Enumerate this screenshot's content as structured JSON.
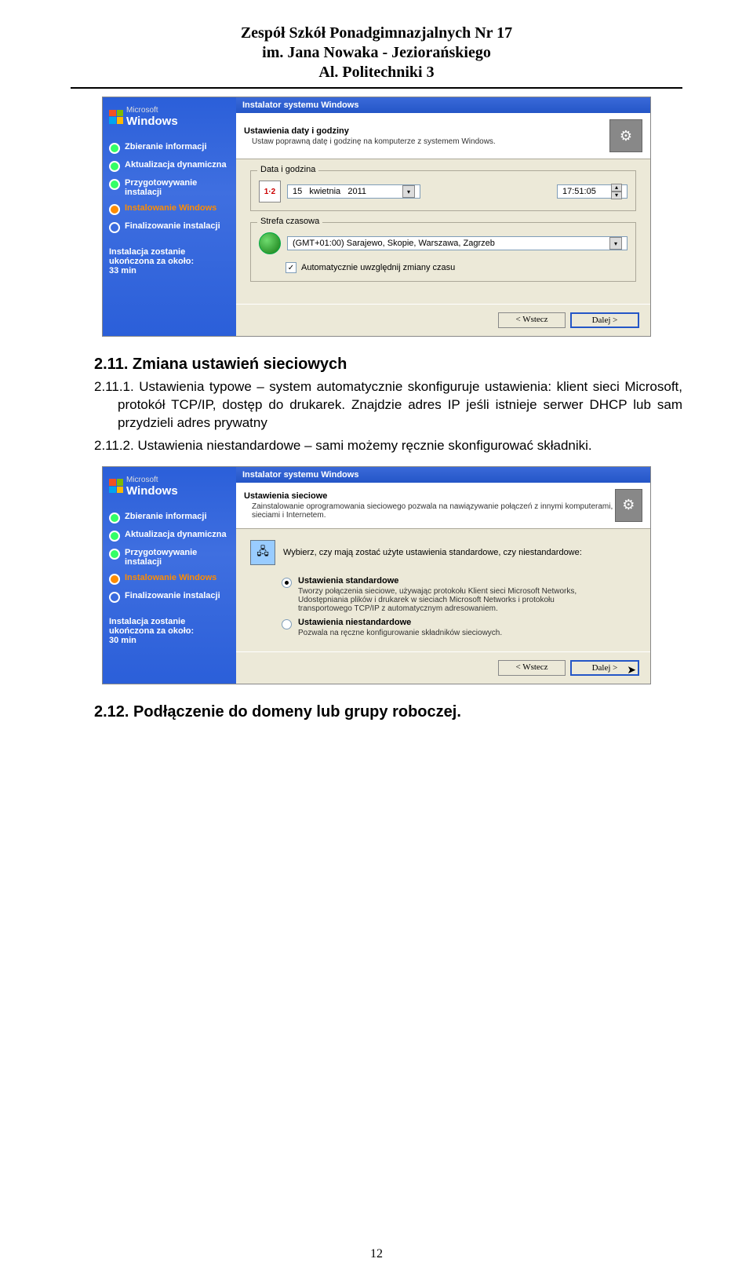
{
  "header": {
    "line1": "Zespół Szkół Ponadgimnazjalnych Nr 17",
    "line2": "im. Jana Nowaka - Jeziorańskiego",
    "line3": "Al. Politechniki 3"
  },
  "screenshot1": {
    "winBrand": {
      "small": "Microsoft",
      "big": "Windows"
    },
    "steps": [
      {
        "label": "Zbieranie informacji",
        "state": "done"
      },
      {
        "label": "Aktualizacja dynamiczna",
        "state": "done"
      },
      {
        "label": "Przygotowywanie instalacji",
        "state": "done"
      },
      {
        "label": "Instalowanie Windows",
        "state": "current"
      },
      {
        "label": "Finalizowanie instalacji",
        "state": "pending"
      }
    ],
    "etaLabel": "Instalacja zostanie ukończona za około:",
    "etaValue": "33 min",
    "dialogTitle": "Instalator systemu Windows",
    "headerTitle": "Ustawienia daty i godziny",
    "headerSub": "Ustaw poprawną datę i godzinę na komputerze z systemem Windows.",
    "groupDate": {
      "legend": "Data i godzina",
      "day": "15",
      "month": "kwietnia",
      "year": "2011",
      "time": "17:51:05"
    },
    "groupTz": {
      "legend": "Strefa czasowa",
      "value": "(GMT+01:00) Sarajewo, Skopie, Warszawa, Zagrzeb",
      "checkboxLabel": "Automatycznie uwzględnij zmiany czasu",
      "checked": true
    },
    "buttons": {
      "back": "< Wstecz",
      "next": "Dalej >"
    }
  },
  "section211": {
    "title": "2.11. Zmiana ustawień sieciowych",
    "p1": "2.11.1. Ustawienia typowe – system automatycznie skonfiguruje ustawienia: klient sieci Microsoft, protokół TCP/IP, dostęp do drukarek. Znajdzie adres IP jeśli istnieje serwer DHCP lub sam przydzieli adres prywatny",
    "p2": "2.11.2. Ustawienia niestandardowe – sami możemy ręcznie skonfigurować składniki."
  },
  "screenshot2": {
    "winBrand": {
      "small": "Microsoft",
      "big": "Windows"
    },
    "steps": [
      {
        "label": "Zbieranie informacji",
        "state": "done"
      },
      {
        "label": "Aktualizacja dynamiczna",
        "state": "done"
      },
      {
        "label": "Przygotowywanie instalacji",
        "state": "done"
      },
      {
        "label": "Instalowanie Windows",
        "state": "current"
      },
      {
        "label": "Finalizowanie instalacji",
        "state": "pending"
      }
    ],
    "etaLabel": "Instalacja zostanie ukończona za około:",
    "etaValue": "30 min",
    "dialogTitle": "Instalator systemu Windows",
    "headerTitle": "Ustawienia sieciowe",
    "headerSub": "Zainstalowanie oprogramowania sieciowego pozwala na nawiązywanie połączeń z innymi komputerami, sieciami i Internetem.",
    "prompt": "Wybierz, czy mają zostać użyte ustawienia standardowe, czy niestandardowe:",
    "options": [
      {
        "title": "Ustawienia standardowe",
        "desc": "Tworzy połączenia sieciowe, używając protokołu Klient sieci Microsoft Networks, Udostępniania plików i drukarek w sieciach Microsoft Networks i protokołu transportowego TCP/IP z automatycznym adresowaniem.",
        "checked": true
      },
      {
        "title": "Ustawienia niestandardowe",
        "desc": "Pozwala na ręczne konfigurowanie składników sieciowych.",
        "checked": false
      }
    ],
    "buttons": {
      "back": "< Wstecz",
      "next": "Dalej >"
    }
  },
  "section212": {
    "title": "2.12. Podłączenie do domeny lub grupy roboczej."
  },
  "pageNumber": "12"
}
